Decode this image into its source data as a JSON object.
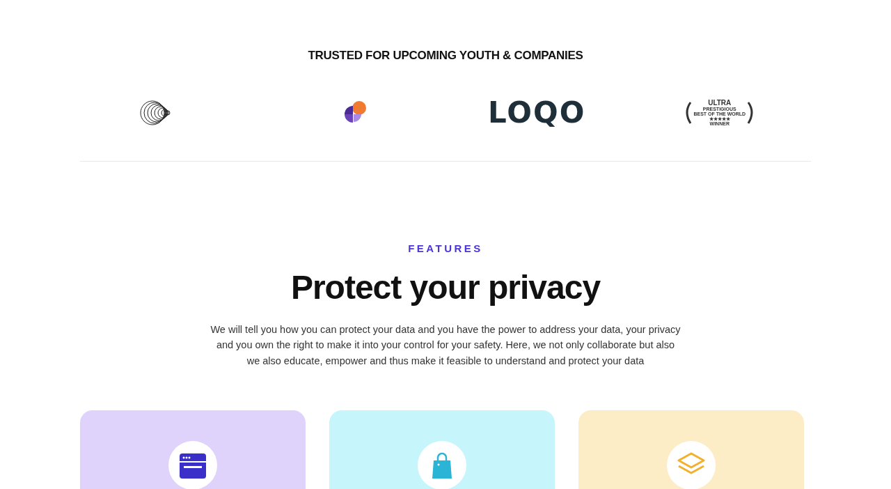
{
  "trusted": {
    "heading": "TRUSTED FOR UPCOMING YOUTH & COMPANIES",
    "logos": [
      {
        "kind": "rings"
      },
      {
        "kind": "petals"
      },
      {
        "kind": "wordmark",
        "text": "LOQO"
      },
      {
        "kind": "laurel",
        "lines": [
          "ULTRA",
          "PRESTIGIOUS",
          "BEST OF THE WORLD",
          "★★★★★",
          "WINNER"
        ]
      }
    ]
  },
  "features": {
    "eyebrow": "FEATURES",
    "title": "Protect your privacy",
    "description": "We will tell you how you can protect your data and you have the power to address your data, your privacy and you own the right to make it into your control for your safety. Here, we not only collaborate but also we also educate, empower and thus make it feasible to understand and protect your data",
    "cards": [
      {
        "kind": "browser",
        "color": "#dfd3fb"
      },
      {
        "kind": "bag",
        "color": "#c6f6fb"
      },
      {
        "kind": "layers",
        "color": "#fdedc6"
      }
    ]
  }
}
